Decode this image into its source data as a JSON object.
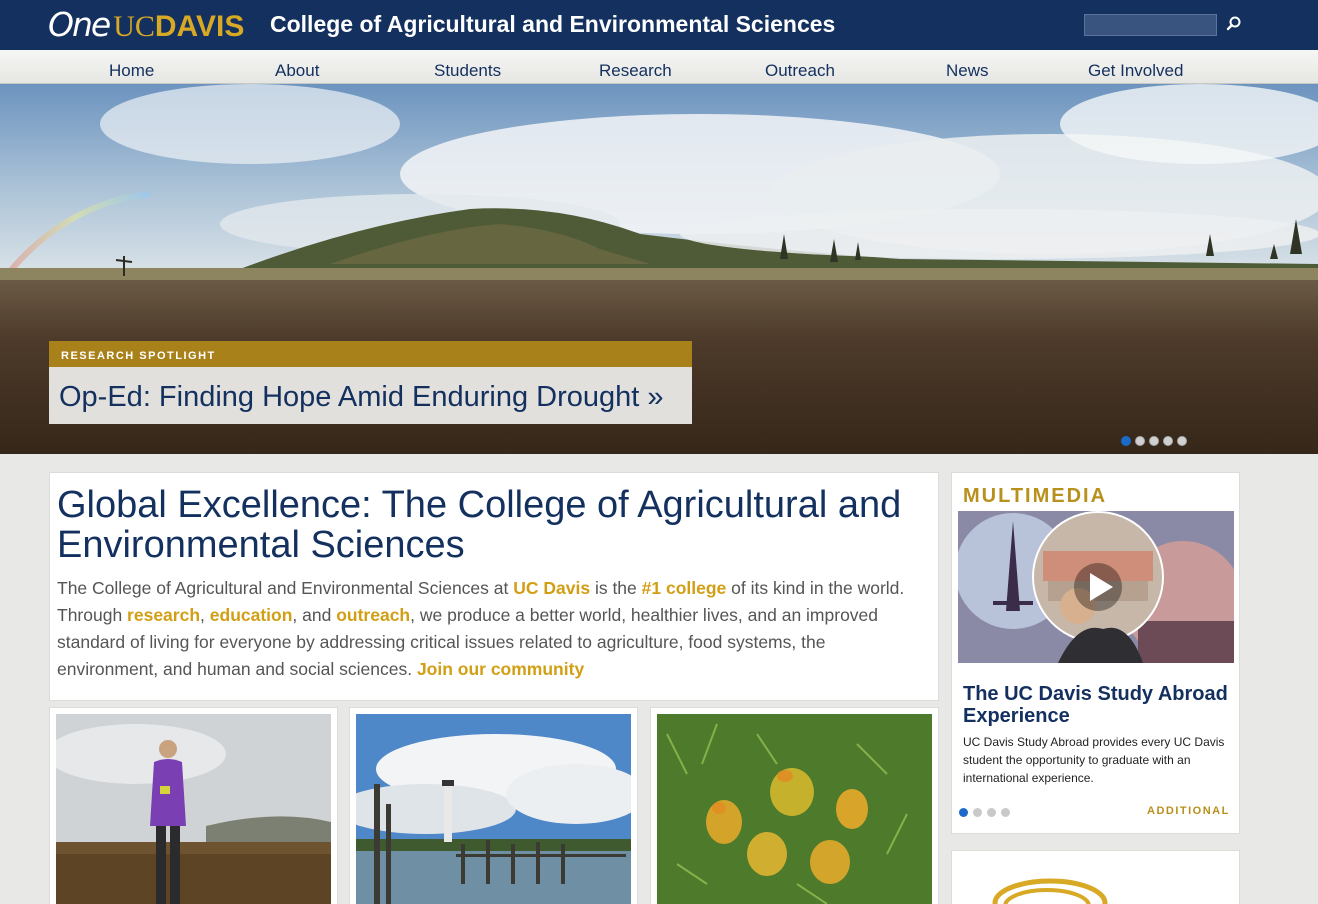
{
  "header": {
    "logo": {
      "one": "One",
      "uc": "UC",
      "davis": "DAVIS"
    },
    "title": "College of Agricultural and Environmental Sciences",
    "search_placeholder": "",
    "search_icon": "search-icon"
  },
  "nav": {
    "items": [
      {
        "label": "Home"
      },
      {
        "label": "About"
      },
      {
        "label": "Students"
      },
      {
        "label": "Research"
      },
      {
        "label": "Outreach"
      },
      {
        "label": "News"
      },
      {
        "label": "Get Involved"
      }
    ]
  },
  "hero": {
    "category": "RESEARCH SPOTLIGHT",
    "title": "Op-Ed: Finding Hope Amid Enduring Drought »",
    "slide_count": 5,
    "active_slide": 1
  },
  "intro": {
    "heading": "Global Excellence: The College of Agricultural and Environmental Sciences",
    "p1": "The College of Agricultural and Environmental Sciences at ",
    "link_ucdavis": "UC Davis",
    "p2": " is the ",
    "link_first": "#1 college",
    "p3": " of its kind in the world. Through ",
    "link_research": "research",
    "p4": ", ",
    "link_education": "education",
    "p5": ", and ",
    "link_outreach": "outreach",
    "p6": ", we produce a better world, healthier lives, and an improved standard of living for everyone by addressing critical issues related to agriculture, food systems, the environment, and human and social sciences. ",
    "link_join": "Join our community"
  },
  "multimedia": {
    "heading": "MULTIMEDIA",
    "title": "The UC Davis Study Abroad Experience",
    "description": "UC Davis Study Abroad provides every UC Davis student the opportunity to graduate with an international experience.",
    "more_label": "ADDITIONAL",
    "slide_count": 4,
    "active_slide": 1,
    "play_icon": "play-icon"
  },
  "colors": {
    "navy": "#13305f",
    "gold": "#d29f14",
    "band_gold": "#a9811b",
    "dot_active": "#1b6ac9"
  }
}
